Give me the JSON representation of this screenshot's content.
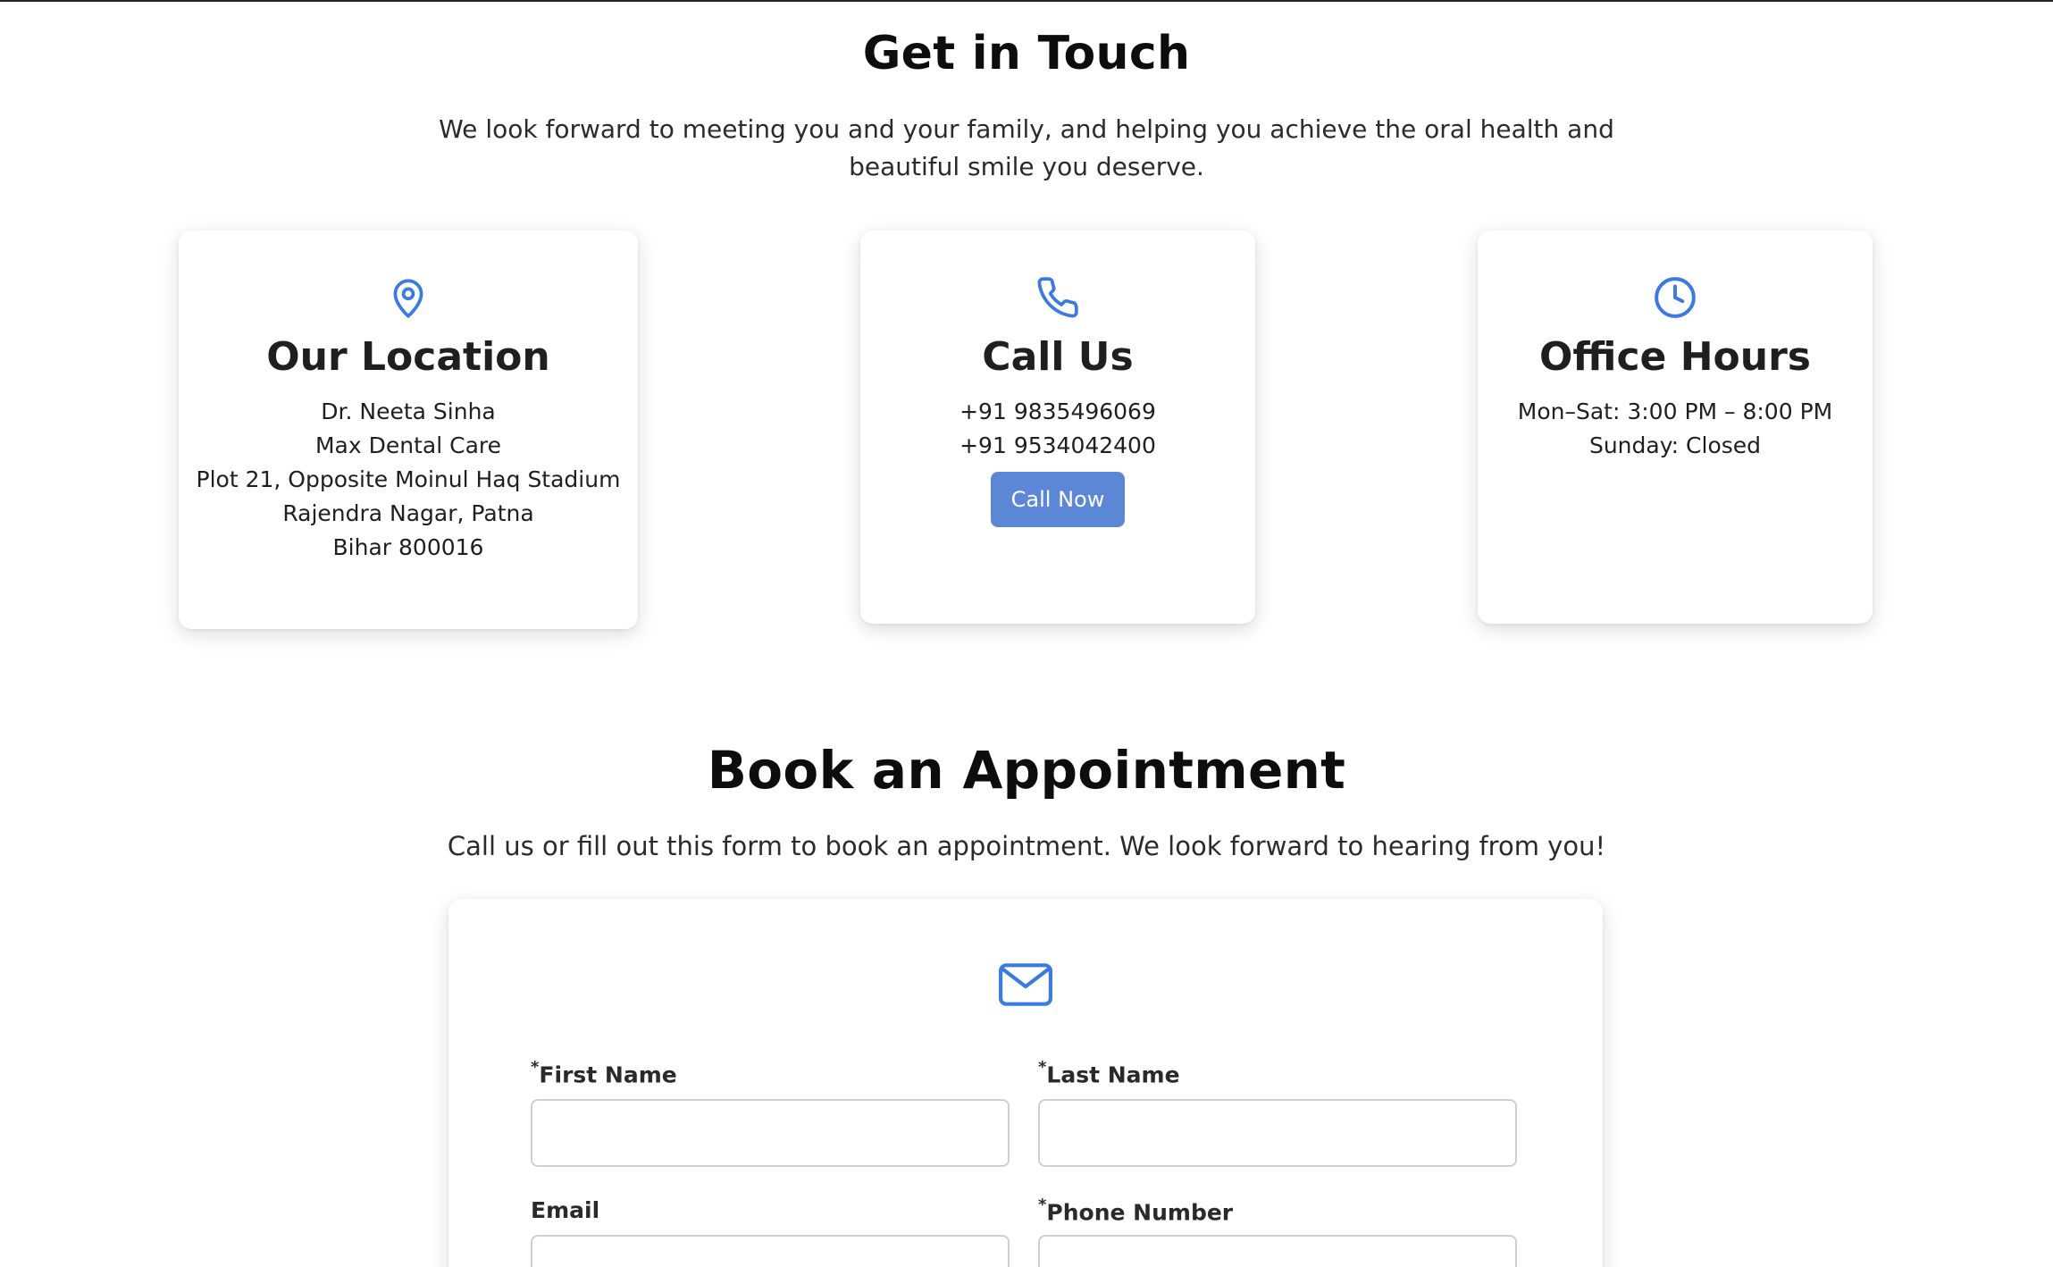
{
  "contact": {
    "title": "Get in Touch",
    "subtitle_line1": "We look forward to meeting you and your family, and helping you achieve the oral health and",
    "subtitle_line2": "beautiful smile you deserve.",
    "location": {
      "icon": "map-pin-icon",
      "title": "Our Location",
      "lines": [
        "Dr. Neeta Sinha",
        "Max Dental Care",
        "Plot 21, Opposite Moinul Haq Stadium",
        "Rajendra Nagar, Patna",
        "Bihar 800016"
      ]
    },
    "call": {
      "icon": "phone-icon",
      "title": "Call Us",
      "phones": [
        "+91 9835496069",
        "+91 9534042400"
      ],
      "button_label": "Call Now"
    },
    "hours": {
      "icon": "clock-icon",
      "title": "Office Hours",
      "lines": [
        "Mon–Sat: 3:00 PM – 8:00 PM",
        "Sunday: Closed"
      ]
    }
  },
  "appointment": {
    "title": "Book an Appointment",
    "subtitle": "Call us or fill out this form to book an appointment. We look forward to hearing from you!",
    "form": {
      "icon": "mail-icon",
      "required_marker": "*",
      "first_name_label": "First Name",
      "last_name_label": "Last Name",
      "email_label": "Email",
      "phone_label": "Phone Number",
      "first_name_value": "",
      "last_name_value": "",
      "email_value": "",
      "phone_value": ""
    }
  },
  "colors": {
    "accent": "#3b7be0",
    "button": "#5b87d6",
    "input_border": "#cfcfcf"
  }
}
